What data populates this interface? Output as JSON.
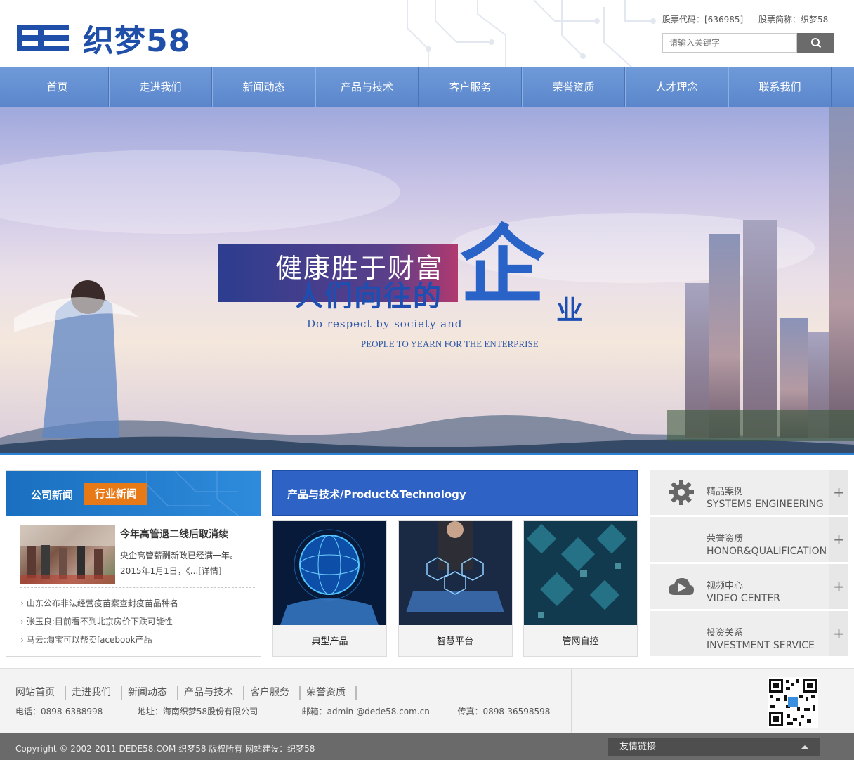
{
  "brand": {
    "logo_text": "织梦58",
    "accent": "#1f4fa8"
  },
  "header": {
    "stock_code_label": "股票代码：[636985]",
    "stock_name_label": "股票简称：织梦58"
  },
  "search": {
    "placeholder": "请输入关键字",
    "button_icon": "search-icon"
  },
  "nav": {
    "items": [
      "首页",
      "走进我们",
      "新闻动态",
      "产品与技术",
      "客户服务",
      "荣誉资质",
      "人才理念",
      "联系我们"
    ]
  },
  "banner": {
    "line1": "健康胜于财富",
    "line2": "人们向往的",
    "big_char": "企",
    "small_char": "业",
    "en1": "Do respect by society and",
    "en2": "PEOPLE TO YEARN FOR THE ENTERPRISE"
  },
  "news": {
    "tab_company": "公司新闻",
    "tab_industry": "行业新闻",
    "feature_title": "今年高管退二线后取消续",
    "feature_summary": "央企高管薪酬新政已经满一年。2015年1月1日，《...[详情]",
    "list": [
      "山东公布非法经营疫苗案查封疫苗品种名",
      "张玉良:目前看不到北京房价下跌可能性",
      "马云:淘宝可以帮卖facebook产品"
    ],
    "bullet": "›"
  },
  "products": {
    "heading": "产品与技术/Product&Technology",
    "cards": [
      {
        "label": "典型产品"
      },
      {
        "label": "智慧平台"
      },
      {
        "label": "管网自控"
      }
    ]
  },
  "side": {
    "items": [
      {
        "cn": "精品案例",
        "en": "SYSTEMS ENGINEERING",
        "icon": "gear-icon"
      },
      {
        "cn": "荣誉资质",
        "en": "HONOR&QUALIFICATION",
        "icon": ""
      },
      {
        "cn": "视频中心",
        "en": "VIDEO CENTER",
        "icon": "cloud-play-icon"
      },
      {
        "cn": "投资关系",
        "en": "INVESTMENT SERVICE",
        "icon": ""
      }
    ],
    "plus": "+"
  },
  "footer": {
    "links": [
      "网站首页",
      "走进我们",
      "新闻动态",
      "产品与技术",
      "客户服务",
      "荣誉资质"
    ],
    "phone": "电话：0898-6388998",
    "address": "地址：海南织梦58股份有限公司",
    "email": "邮箱：admin @dede58.com.cn",
    "fax": "传真：0898-36598598",
    "copyright": "Copyright © 2002-2011 DEDE58.COM 织梦58 版权所有 网站建设：织梦58",
    "friend_links": "友情链接"
  }
}
